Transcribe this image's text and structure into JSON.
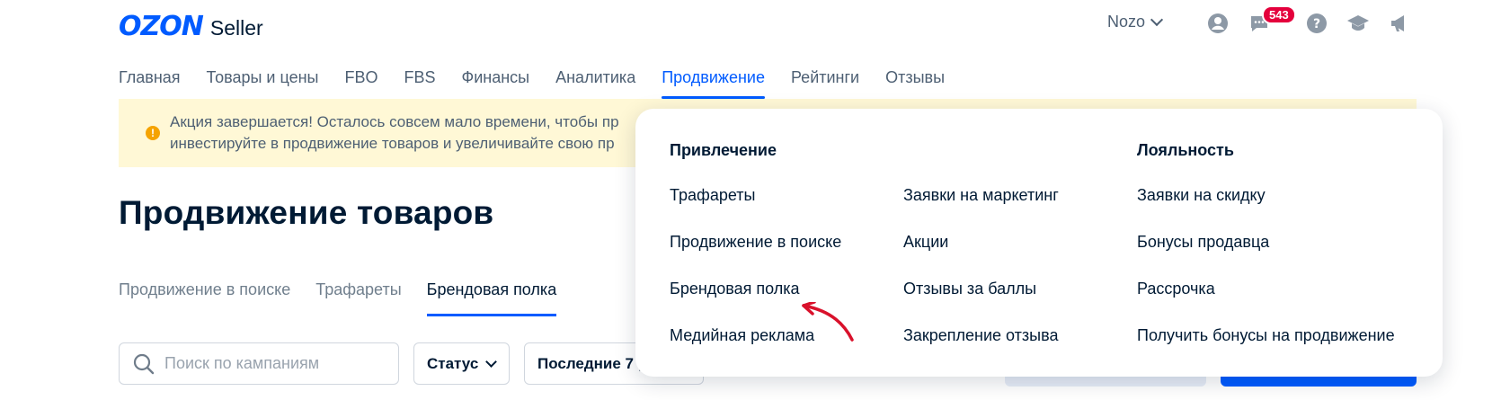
{
  "header": {
    "logo_ozon": "OZON",
    "logo_seller": "Seller",
    "company_name": "Nozo",
    "notification_count": "543",
    "icons": [
      "user-icon",
      "chat-icon",
      "help-icon",
      "education-icon",
      "megaphone-icon"
    ]
  },
  "mainnav": {
    "items": [
      {
        "label": "Главная"
      },
      {
        "label": "Товары и цены"
      },
      {
        "label": "FBO"
      },
      {
        "label": "FBS"
      },
      {
        "label": "Финансы"
      },
      {
        "label": "Аналитика"
      },
      {
        "label": "Продвижение"
      },
      {
        "label": "Рейтинги"
      },
      {
        "label": "Отзывы"
      }
    ],
    "active": "Продвижение"
  },
  "banner": {
    "line1": "Акция завершается! Осталось совсем мало времени, чтобы пр",
    "line2": "инвестируйте в продвижение товаров и увеличивайте свою пр"
  },
  "page": {
    "title": "Продвижение товаров"
  },
  "subtabs": {
    "items": [
      {
        "label": "Продвижение в поиске"
      },
      {
        "label": "Трафареты"
      },
      {
        "label": "Брендовая полка"
      }
    ],
    "active": "Брендовая полка"
  },
  "filters": {
    "search_placeholder": "Поиск по кампаниям",
    "status_label": "Статус",
    "period_label": "Последние 7 ,"
  },
  "dropdown": {
    "col1_heading": "Привлечение",
    "col3_heading": "Лояльность",
    "col1": [
      "Трафареты",
      "Продвижение в поиске",
      "Брендовая полка",
      "Медийная реклама"
    ],
    "col2": [
      "Заявки на маркетинг",
      "Акции",
      "Отзывы за баллы",
      "Закрепление отзыва"
    ],
    "col3": [
      "Заявки на скидку",
      "Бонусы продавца",
      "Рассрочка",
      "Получить бонусы на продвижение"
    ]
  },
  "colors": {
    "accent": "#005bff",
    "banner_bg": "#fff8d6",
    "badge": "#e4003c",
    "annotation_arrow": "#d9112b"
  }
}
